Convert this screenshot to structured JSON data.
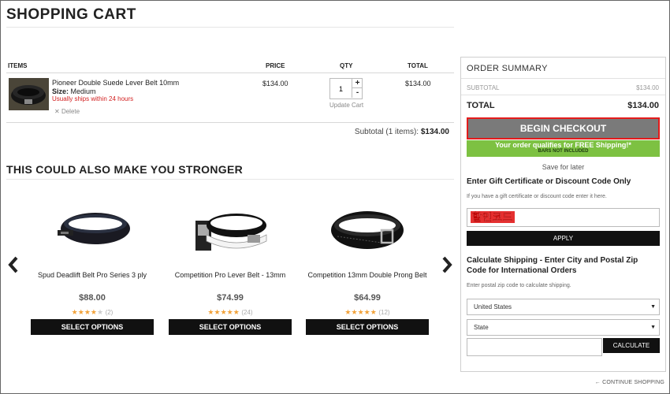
{
  "page": {
    "title": "SHOPPING CART"
  },
  "cart": {
    "headers": {
      "items": "ITEMS",
      "price": "PRICE",
      "qty": "QTY",
      "total": "TOTAL"
    },
    "item": {
      "name": "Pioneer Double Suede Lever Belt 10mm",
      "size_label": "Size:",
      "size_value": "Medium",
      "shipping_note": "Usually ships within 24 hours",
      "delete_label": "Delete",
      "price": "$134.00",
      "quantity": "1",
      "plus": "+",
      "minus": "-",
      "update_label": "Update Cart",
      "total": "$134.00"
    },
    "subtotal_label": "Subtotal (1 items):",
    "subtotal_value": "$134.00"
  },
  "recommendations": {
    "title": "THIS COULD ALSO MAKE YOU STRONGER",
    "items": [
      {
        "name": "Spud Deadlift Belt Pro Series 3 ply",
        "price": "$88.00",
        "rating": 4,
        "reviews": "(2)",
        "button": "SELECT OPTIONS"
      },
      {
        "name": "Competition Pro Lever Belt - 13mm",
        "price": "$74.99",
        "rating": 5,
        "reviews": "(24)",
        "button": "SELECT OPTIONS"
      },
      {
        "name": "Competition 13mm Double Prong Belt",
        "price": "$64.99",
        "rating": 5,
        "reviews": "(12)",
        "button": "SELECT OPTIONS"
      }
    ]
  },
  "summary": {
    "title": "ORDER SUMMARY",
    "subtotal_label": "SUBTOTAL",
    "subtotal_value": "$134.00",
    "total_label": "TOTAL",
    "total_value": "$134.00",
    "checkout_label": "BEGIN CHECKOUT",
    "free_shipping": "Your order qualifies for FREE Shipping!*",
    "free_shipping_note": "BARS NOT INCLUDED",
    "save_later": "Save for later",
    "gift_title": "Enter Gift Certificate or Discount Code Only",
    "gift_help": "If you have a gift certificate or discount code enter it here.",
    "gift_value": "할인코드",
    "apply_label": "APPLY",
    "shipping_title": "Calculate Shipping - Enter City and Postal Zip Code for International Orders",
    "shipping_help": "Enter postal zip code to calculate shipping.",
    "country_value": "United States",
    "state_value": "State",
    "calculate_label": "CALCULATE"
  },
  "footer": {
    "continue_label": "CONTINUE SHOPPING"
  },
  "colors": {
    "checkout_bg": "#7a7a7a",
    "checkout_border": "#e31b1b",
    "free_ship_bg": "#7dc142",
    "ship_note": "#d21e1e",
    "star": "#f2a23a"
  },
  "icons": {
    "prev": "chevron-left-icon",
    "next": "chevron-right-icon",
    "delete": "close-icon",
    "continue": "arrow-left-icon",
    "caret": "caret-down-icon"
  }
}
